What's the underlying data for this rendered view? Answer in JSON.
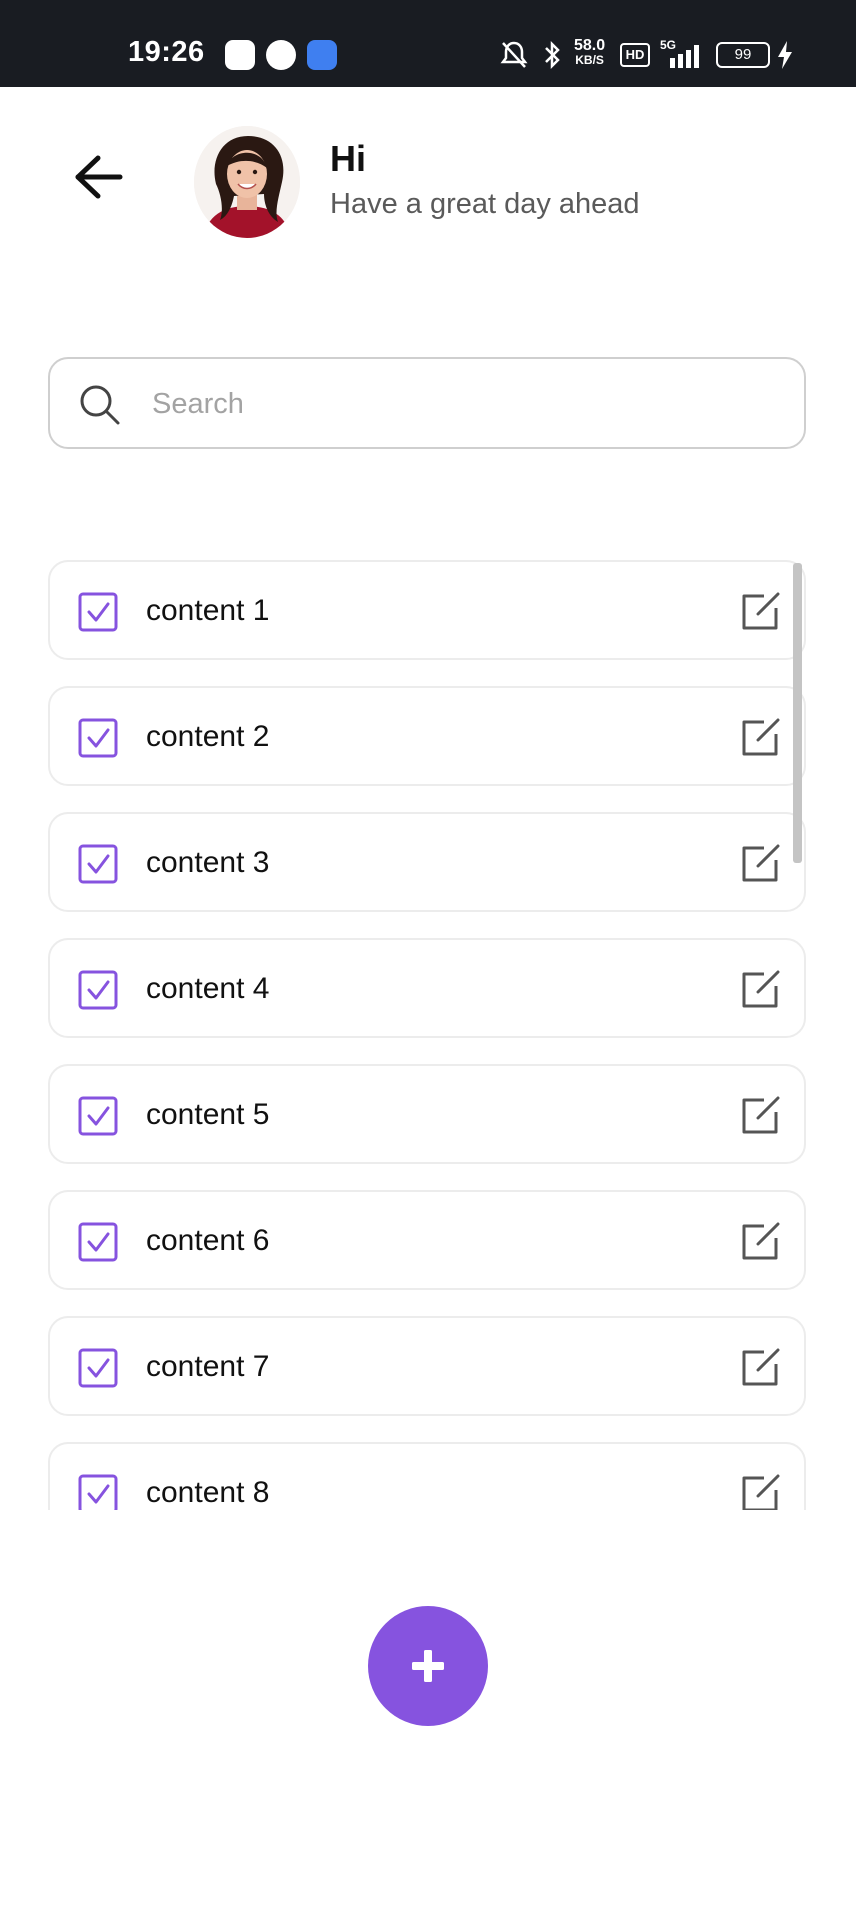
{
  "status_bar": {
    "time": "19:26",
    "net_speed_value": "58.0",
    "net_speed_unit": "KB/S",
    "hd_label": "HD",
    "network_label": "5G",
    "battery": "99"
  },
  "header": {
    "title": "Hi",
    "subtitle": "Have a great day ahead",
    "back_icon": "arrow-left-icon",
    "avatar": "user-avatar"
  },
  "search": {
    "placeholder": "Search",
    "value": "",
    "icon": "search-icon"
  },
  "list": {
    "items": [
      {
        "label": "content 1",
        "checked": true
      },
      {
        "label": "content 2",
        "checked": true
      },
      {
        "label": "content 3",
        "checked": true
      },
      {
        "label": "content 4",
        "checked": true
      },
      {
        "label": "content 5",
        "checked": true
      },
      {
        "label": "content 6",
        "checked": true
      },
      {
        "label": "content 7",
        "checked": true
      },
      {
        "label": "content 8",
        "checked": true
      }
    ],
    "edit_icon": "edit-icon",
    "checkbox_icon": "checkbox-checked-icon"
  },
  "fab": {
    "icon": "plus-icon",
    "label": "+"
  },
  "colors": {
    "accent": "#8653df",
    "status_bar": "#191c22",
    "text": "#111111",
    "subtext": "#5a5a5a",
    "border": "#ececec"
  }
}
